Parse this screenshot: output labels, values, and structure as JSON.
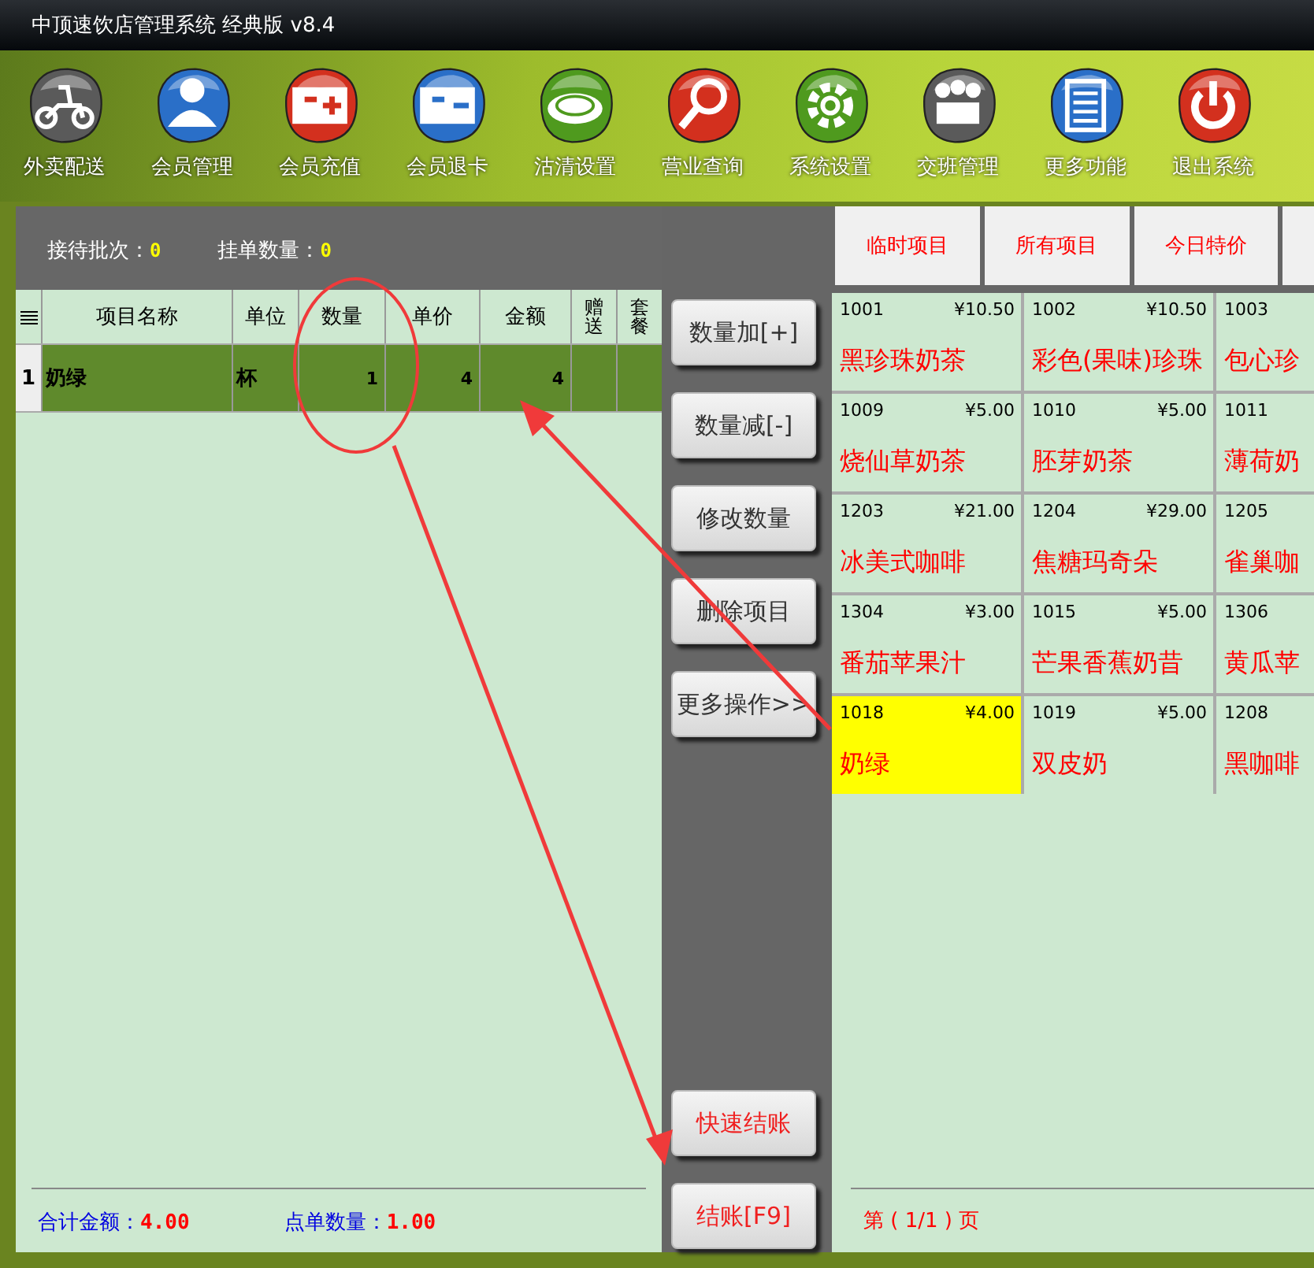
{
  "window": {
    "title": "中顶速饮店管理系统 经典版 v8.4"
  },
  "toolbar": [
    {
      "label": "外卖配送"
    },
    {
      "label": "会员管理"
    },
    {
      "label": "会员充值"
    },
    {
      "label": "会员退卡"
    },
    {
      "label": "沽清设置"
    },
    {
      "label": "营业查询"
    },
    {
      "label": "系统设置"
    },
    {
      "label": "交班管理"
    },
    {
      "label": "更多功能"
    },
    {
      "label": "退出系统"
    }
  ],
  "order_panel": {
    "stats": [
      {
        "label": "接待批次：",
        "value": "0"
      },
      {
        "label": "挂单数量：",
        "value": "0"
      }
    ],
    "table": {
      "columns": [
        "项目名称",
        "单位",
        "数量",
        "单价",
        "金额",
        "赠送",
        "套餐"
      ],
      "rows": [
        {
          "index": "1",
          "cells": [
            "奶绿",
            "杯",
            "1",
            "4",
            "4",
            "",
            ""
          ],
          "selected": true
        }
      ]
    },
    "totals": [
      {
        "label": "合计金额：",
        "value": "4.00"
      },
      {
        "label": "点单数量：",
        "value": "1.00"
      }
    ]
  },
  "actions": [
    {
      "label": "数量加[+]",
      "kind": "edit"
    },
    {
      "label": "数量减[-]",
      "kind": "edit"
    },
    {
      "label": "修改数量",
      "kind": "edit"
    },
    {
      "label": "删除项目",
      "kind": "edit"
    },
    {
      "label": "更多操作>>",
      "kind": "edit"
    }
  ],
  "checkout_actions": [
    {
      "label": "快速结账",
      "kind": "checkout"
    },
    {
      "label": "结账[F9]",
      "kind": "checkout"
    }
  ],
  "menu_panel": {
    "tabs": [
      "临时项目",
      "所有项目",
      "今日特价"
    ],
    "items": [
      {
        "code": "1001",
        "price": "¥10.50",
        "name": "黑珍珠奶茶",
        "selected": false
      },
      {
        "code": "1002",
        "price": "¥10.50",
        "name": "彩色(果味)珍珠",
        "selected": false
      },
      {
        "code": "1003",
        "name": "包心珍",
        "selected": false
      },
      {
        "code": "1009",
        "price": "¥5.00",
        "name": "烧仙草奶茶",
        "selected": false
      },
      {
        "code": "1010",
        "price": "¥5.00",
        "name": "胚芽奶茶",
        "selected": false
      },
      {
        "code": "1011",
        "name": "薄荷奶",
        "selected": false
      },
      {
        "code": "1203",
        "price": "¥21.00",
        "name": "冰美式咖啡",
        "selected": false
      },
      {
        "code": "1204",
        "price": "¥29.00",
        "name": "焦糖玛奇朵",
        "selected": false
      },
      {
        "code": "1205",
        "name": "雀巢咖",
        "selected": false
      },
      {
        "code": "1304",
        "price": "¥3.00",
        "name": "番茄苹果汁",
        "selected": false
      },
      {
        "code": "1015",
        "price": "¥5.00",
        "name": "芒果香蕉奶昔",
        "selected": false
      },
      {
        "code": "1306",
        "name": "黄瓜苹",
        "selected": false
      },
      {
        "code": "1018",
        "price": "¥4.00",
        "name": "奶绿",
        "selected": true
      },
      {
        "code": "1019",
        "price": "¥5.00",
        "name": "双皮奶",
        "selected": false
      },
      {
        "code": "1208",
        "name": "黑咖啡",
        "selected": false
      }
    ],
    "pager": "第 ( 1/1 ) 页"
  }
}
